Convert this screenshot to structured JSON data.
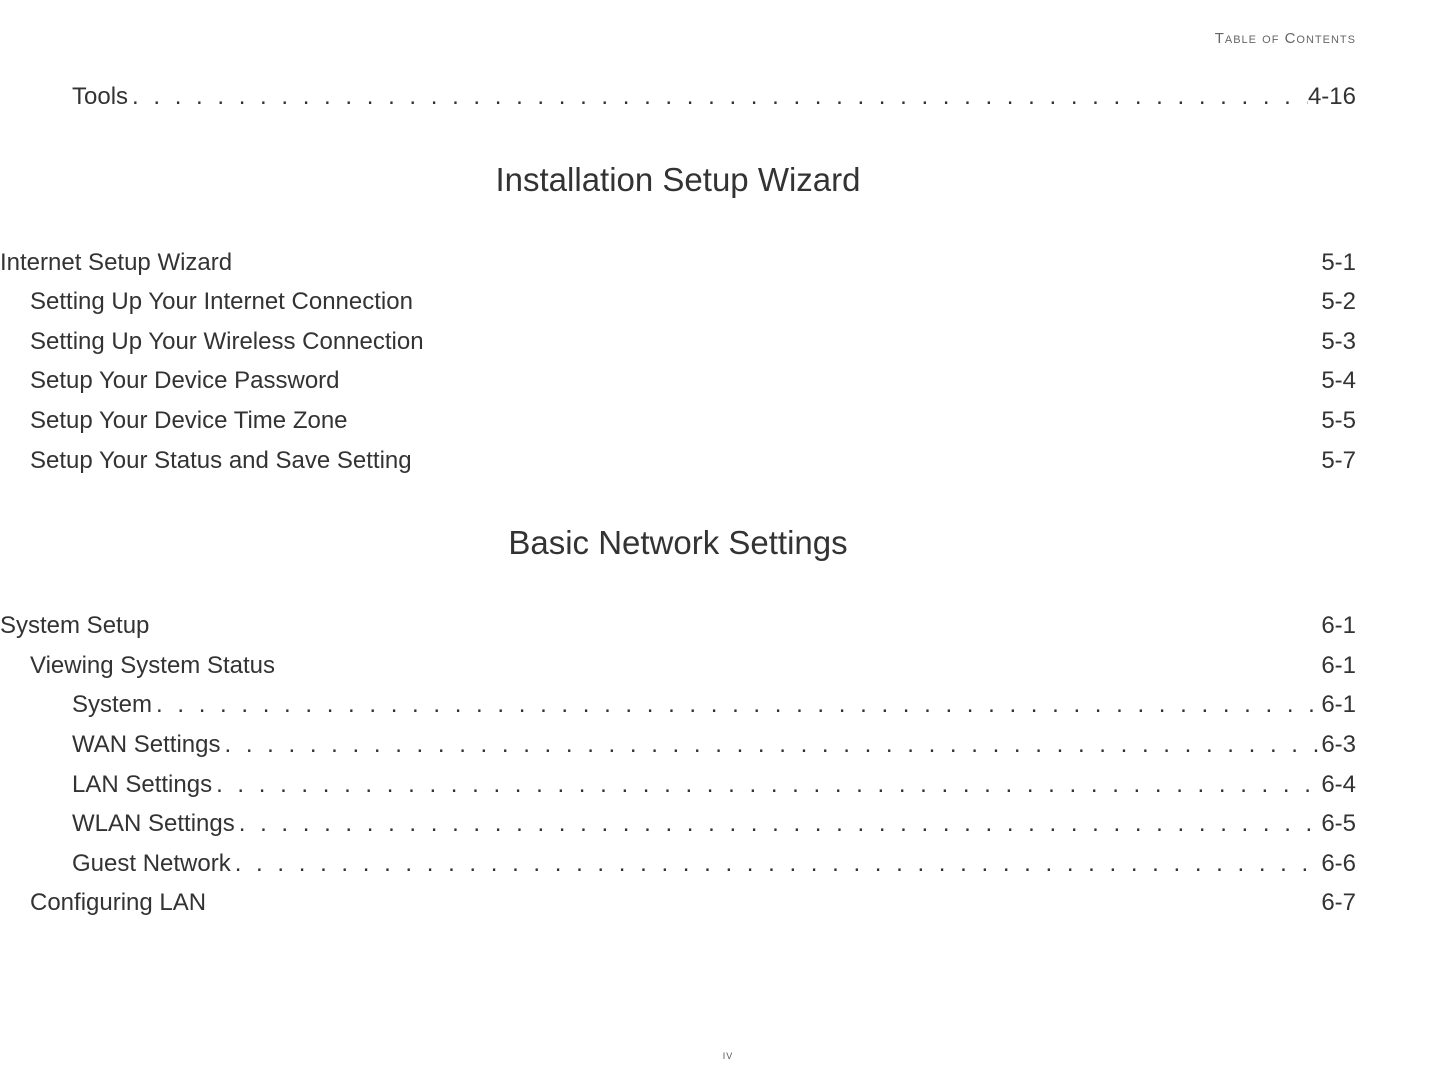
{
  "header": {
    "label": "Table of Contents"
  },
  "entries": {
    "tools": {
      "label": "Tools",
      "page": "4-16"
    },
    "heading_install": "Installation Setup Wizard",
    "internet_setup_wizard": {
      "label": "Internet Setup Wizard",
      "page": "5-1"
    },
    "setting_up_internet": {
      "label": "Setting Up Your Internet Connection",
      "page": "5-2"
    },
    "setting_up_wireless": {
      "label": "Setting Up Your Wireless Connection",
      "page": "5-3"
    },
    "setup_device_password": {
      "label": "Setup Your Device Password",
      "page": "5-4"
    },
    "setup_device_timezone": {
      "label": "Setup Your Device Time Zone",
      "page": "5-5"
    },
    "setup_status_save": {
      "label": "Setup Your Status and Save Setting",
      "page": "5-7"
    },
    "heading_basic": "Basic Network Settings",
    "system_setup": {
      "label": "System Setup",
      "page": "6-1"
    },
    "viewing_system_status": {
      "label": "Viewing System Status",
      "page": "6-1"
    },
    "system": {
      "label": "System",
      "page": "6-1"
    },
    "wan_settings": {
      "label": "WAN Settings",
      "page": "6-3"
    },
    "lan_settings": {
      "label": "LAN Settings",
      "page": "6-4"
    },
    "wlan_settings": {
      "label": "WLAN Settings",
      "page": "6-5"
    },
    "guest_network": {
      "label": "Guest Network",
      "page": "6-6"
    },
    "configuring_lan": {
      "label": "Configuring LAN",
      "page": "6-7"
    }
  },
  "footer": {
    "page_number": "iv"
  }
}
